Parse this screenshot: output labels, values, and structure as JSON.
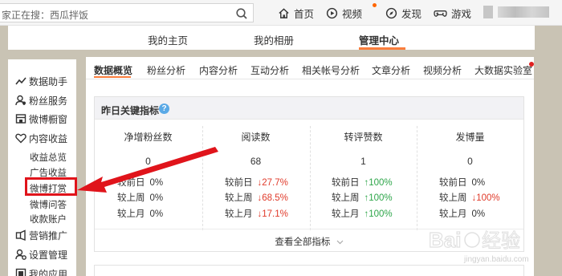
{
  "topbar": {
    "search_text": "家正在搜：西瓜拌饭",
    "nav": [
      {
        "label": "首页",
        "icon": "home-icon"
      },
      {
        "label": "视频",
        "icon": "video-icon"
      },
      {
        "label": "发现",
        "icon": "compass-icon"
      },
      {
        "label": "游戏",
        "icon": "gamepad-icon"
      }
    ]
  },
  "header": {
    "tabs": [
      "我的主页",
      "我的相册",
      "管理中心"
    ],
    "active_tab": "管理中心"
  },
  "sidebar": {
    "items": [
      {
        "label": "数据助手",
        "icon": "chart-icon"
      },
      {
        "label": "粉丝服务",
        "icon": "user-icon"
      },
      {
        "label": "微博橱窗",
        "icon": "shop-icon"
      },
      {
        "label": "内容收益",
        "icon": "heart-icon"
      }
    ],
    "subitems": [
      "收益总览",
      "广告收益",
      "微博打赏",
      "微博问答",
      "收款账户"
    ],
    "items_after": [
      {
        "label": "营销推广",
        "icon": "megaphone-icon"
      },
      {
        "label": "设置管理",
        "icon": "user-gear-icon"
      },
      {
        "label": "我的应用",
        "icon": "apps-icon"
      }
    ],
    "highlighted": "微博打赏"
  },
  "main": {
    "tabs": [
      "数据概览",
      "粉丝分析",
      "内容分析",
      "互动分析",
      "相关帐号分析",
      "文章分析",
      "视频分析",
      "大数据实验室"
    ],
    "active_tab": "数据概览",
    "card_title": "昨日关键指标",
    "help_mark": "?",
    "metrics": [
      {
        "label": "净增粉丝数",
        "value": "0",
        "compare": [
          {
            "k": "较前日",
            "v": "0%",
            "dir": "flat"
          },
          {
            "k": "较上周",
            "v": "0%",
            "dir": "flat"
          },
          {
            "k": "较上月",
            "v": "0%",
            "dir": "flat"
          }
        ]
      },
      {
        "label": "阅读数",
        "value": "68",
        "compare": [
          {
            "k": "较前日",
            "v": "27.7%",
            "dir": "down"
          },
          {
            "k": "较上周",
            "v": "68.5%",
            "dir": "down"
          },
          {
            "k": "较上月",
            "v": "17.1%",
            "dir": "down"
          }
        ]
      },
      {
        "label": "转评赞数",
        "value": "1",
        "compare": [
          {
            "k": "较前日",
            "v": "100%",
            "dir": "up"
          },
          {
            "k": "较上周",
            "v": "100%",
            "dir": "up"
          },
          {
            "k": "较上月",
            "v": "100%",
            "dir": "up"
          }
        ]
      },
      {
        "label": "发博量",
        "value": "0",
        "compare": [
          {
            "k": "较前日",
            "v": "0%",
            "dir": "flat"
          },
          {
            "k": "较上周",
            "v": "100%",
            "dir": "down"
          },
          {
            "k": "较上月",
            "v": "0%",
            "dir": "flat"
          }
        ]
      }
    ],
    "more_label": "查看全部指标"
  },
  "colors": {
    "accent": "#fa7d3c",
    "down": "#e03a2a",
    "up": "#2ea64a",
    "highlight_box": "#e0141b"
  },
  "watermark": {
    "brand": "Baidu经验",
    "url": "jingyan.baidu.com"
  }
}
